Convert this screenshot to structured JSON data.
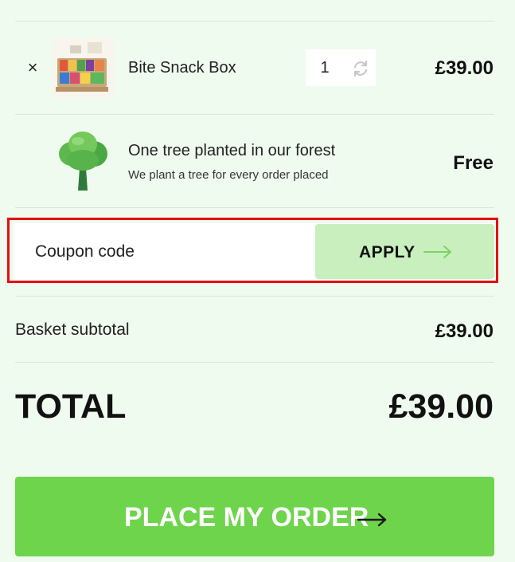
{
  "cart": {
    "item": {
      "remove_symbol": "×",
      "name": "Bite Snack Box",
      "quantity": "1",
      "price": "£39.00",
      "refresh_icon": "refresh-icon",
      "thumb_icon": "product-thumbnail"
    },
    "tree_offer": {
      "title": "One tree planted in our forest",
      "subtitle": "We plant a tree for every order placed",
      "price": "Free",
      "icon": "tree-icon"
    }
  },
  "coupon": {
    "placeholder": "Coupon code",
    "apply_label": "APPLY",
    "arrow_icon": "arrow-right-icon"
  },
  "summary": {
    "subtotal_label": "Basket subtotal",
    "subtotal_value": "£39.00",
    "total_label": "TOTAL",
    "total_value": "£39.00"
  },
  "checkout": {
    "place_order_label": "PLACE MY ORDER",
    "arrow_icon": "arrow-right-icon"
  },
  "colors": {
    "background": "#f0fbef",
    "apply_button": "#c9efbf",
    "place_order_button": "#6ed44c",
    "highlight_border": "#e41010"
  }
}
